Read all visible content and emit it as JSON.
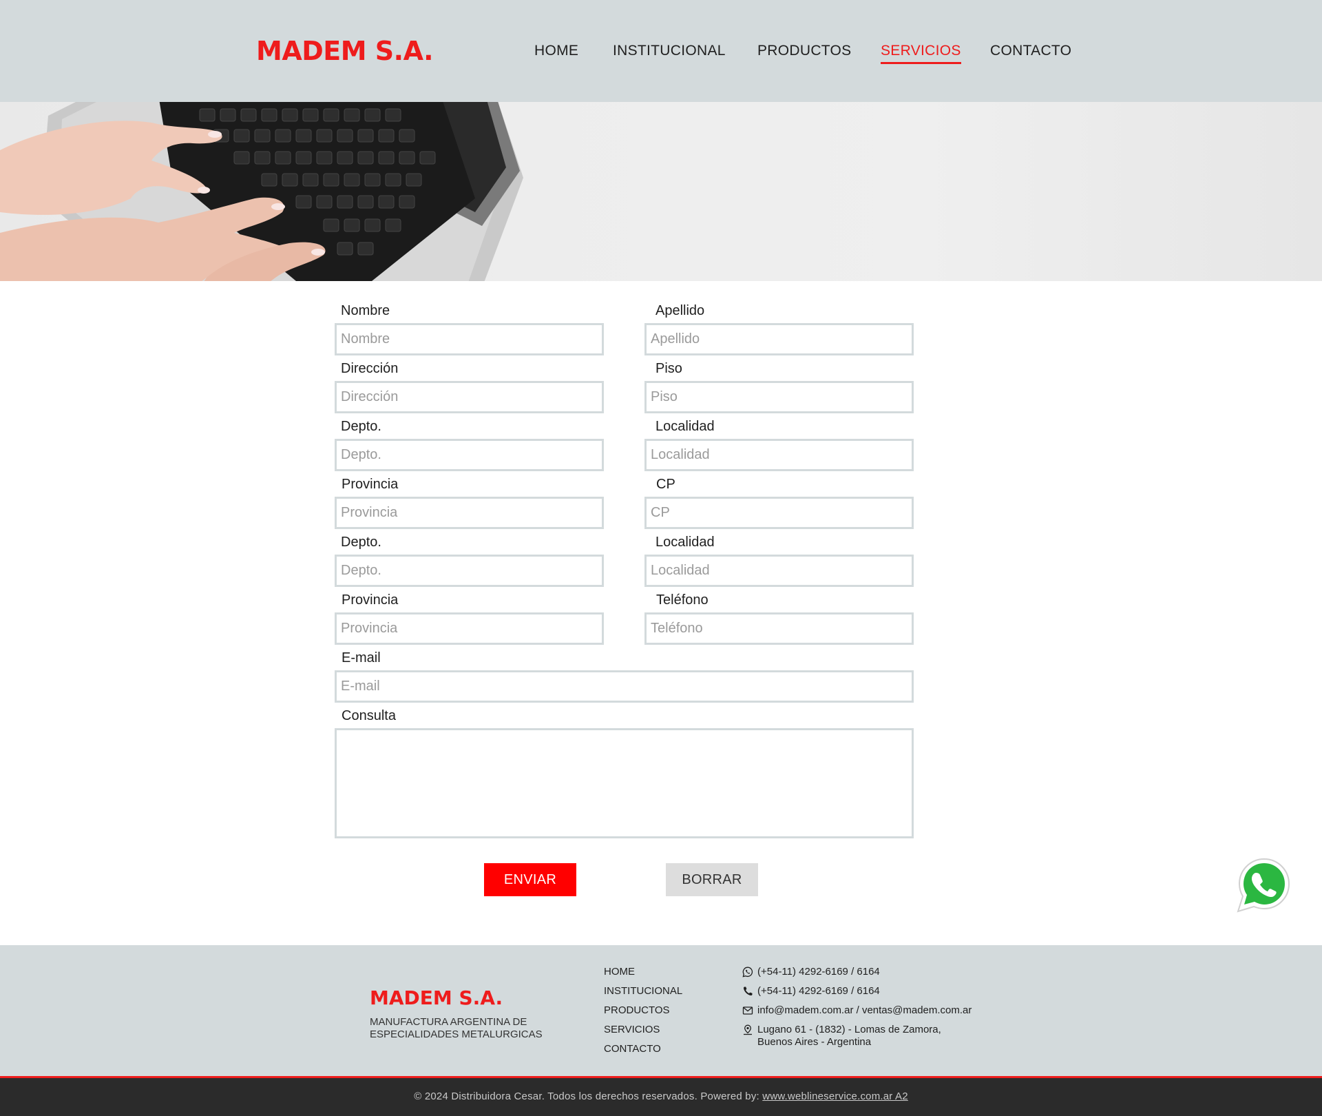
{
  "header": {
    "logo": "MADEM S.A.",
    "nav": [
      {
        "label": "HOME",
        "active": false
      },
      {
        "label": "INSTITUCIONAL",
        "active": false
      },
      {
        "label": "PRODUCTOS",
        "active": false
      },
      {
        "label": "SERVICIOS",
        "active": true
      },
      {
        "label": "CONTACTO",
        "active": false
      }
    ]
  },
  "form": {
    "fields": {
      "nombre": {
        "label": "Nombre",
        "placeholder": "Nombre"
      },
      "apellido": {
        "label": "Apellido",
        "placeholder": "Apellido"
      },
      "direccion": {
        "label": "Dirección",
        "placeholder": "Dirección"
      },
      "piso": {
        "label": "Piso",
        "placeholder": "Piso"
      },
      "depto1": {
        "label": "Depto.",
        "placeholder": "Depto."
      },
      "localidad1": {
        "label": "Localidad",
        "placeholder": "Localidad"
      },
      "provincia1": {
        "label": "Provincia",
        "placeholder": "Provincia"
      },
      "cp": {
        "label": "CP",
        "placeholder": "CP"
      },
      "depto2": {
        "label": "Depto.",
        "placeholder": "Depto."
      },
      "localidad2": {
        "label": "Localidad",
        "placeholder": "Localidad"
      },
      "provincia2": {
        "label": "Provincia",
        "placeholder": "Provincia"
      },
      "telefono": {
        "label": "Teléfono",
        "placeholder": "Teléfono"
      },
      "email": {
        "label": "E-mail",
        "placeholder": "E-mail"
      },
      "consulta": {
        "label": "Consulta"
      }
    },
    "submit_label": "ENVIAR",
    "reset_label": "BORRAR"
  },
  "footer": {
    "logo": "MADEM S.A.",
    "tagline": "MANUFACTURA ARGENTINA DE ESPECIALIDADES METALURGICAS",
    "links": [
      "HOME",
      "INSTITUCIONAL",
      "PRODUCTOS",
      "SERVICIOS",
      "CONTACTO"
    ],
    "contact": {
      "whatsapp": "(+54-11) 4292-6169 / 6164",
      "phone": "(+54-11) 4292-6169 / 6164",
      "email": "info@madem.com.ar / ventas@madem.com.ar",
      "address_line1": "Lugano 61 - (1832) - Lomas de Zamora,",
      "address_line2": "Buenos Aires - Argentina"
    },
    "copyright": "© 2024 Distribuidora Cesar. Todos los derechos reservados. Powered by: ",
    "powered_link": "www.weblineservice.com.ar A2"
  },
  "colors": {
    "brand_red": "#ee1c1c",
    "header_bg": "#d3dadc",
    "bottom_bar": "#2b2b2b",
    "whatsapp_green": "#2bb741"
  },
  "icons": [
    "whatsapp-icon",
    "phone-icon",
    "mail-icon",
    "location-icon",
    "whatsapp-float-icon"
  ]
}
